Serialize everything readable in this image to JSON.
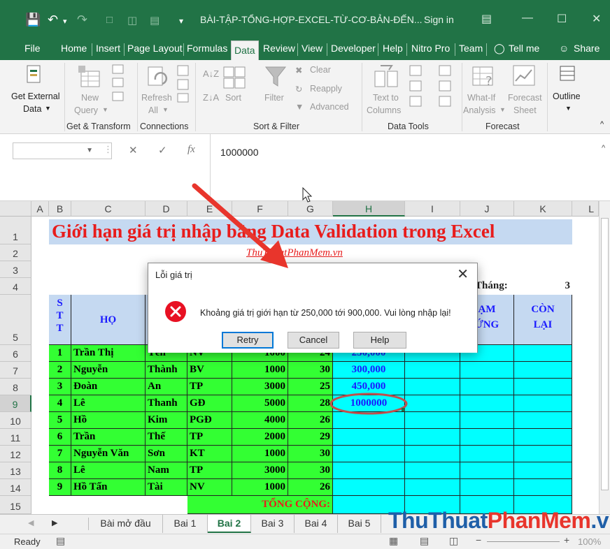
{
  "window": {
    "title": "BÀI-TẬP-TỔNG-HỢP-EXCEL-TỪ-CƠ-BẢN-ĐẾN...",
    "signin": "Sign in"
  },
  "tabs": [
    "File",
    "Home",
    "Insert",
    "Page Layout",
    "Formulas",
    "Data",
    "Review",
    "View",
    "Developer",
    "Help",
    "Nitro Pro",
    "Team"
  ],
  "tell_me": "Tell me",
  "share": "Share",
  "ribbon": {
    "get_external_data_l1": "Get External",
    "get_external_data_l2": "Data",
    "new_query_l1": "New",
    "new_query_l2": "Query",
    "refresh_all_l1": "Refresh",
    "refresh_all_l2": "All",
    "sort": "Sort",
    "filter": "Filter",
    "clear": "Clear",
    "reapply": "Reapply",
    "advanced": "Advanced",
    "text_to_columns_l1": "Text to",
    "text_to_columns_l2": "Columns",
    "what_if_l1": "What-If",
    "what_if_l2": "Analysis",
    "forecast_sheet_l1": "Forecast",
    "forecast_sheet_l2": "Sheet",
    "outline": "Outline",
    "groups": [
      "Get & Transform",
      "Connections",
      "Sort & Filter",
      "Data Tools",
      "Forecast"
    ]
  },
  "formula_bar": {
    "fx": "fx",
    "value": "1000000"
  },
  "columns": [
    "A",
    "B",
    "C",
    "D",
    "E",
    "F",
    "G",
    "H",
    "I",
    "J",
    "K",
    "L"
  ],
  "rows": [
    "1",
    "2",
    "3",
    "4",
    "5",
    "6",
    "7",
    "8",
    "9",
    "10",
    "11",
    "12",
    "13",
    "14",
    "15"
  ],
  "sheet": {
    "title": "Giới hạn giá trị nhập bằng Data Validation trong Excel",
    "subtitle": "ThuThuatPhanMem.vn",
    "month_label": "Tháng:",
    "month_value": "3",
    "header_stt": [
      "S",
      "T",
      "T"
    ],
    "header_ho": "HỌ",
    "header_tam_l1": "ẠM",
    "header_tam_l2": "ỨNG",
    "header_con_l1": "CÒN",
    "header_con_l2": "LẠI",
    "data_rows": [
      {
        "stt": "1",
        "ho": "Trần Thị",
        "ten": "Yến",
        "cv": "NV",
        "f": "1000",
        "g": "24",
        "h": "250,000"
      },
      {
        "stt": "2",
        "ho": "Nguyễn",
        "ten": "Thành",
        "cv": "BV",
        "f": "1000",
        "g": "30",
        "h": "300,000"
      },
      {
        "stt": "3",
        "ho": "Đoàn",
        "ten": "An",
        "cv": "TP",
        "f": "3000",
        "g": "25",
        "h": "450,000"
      },
      {
        "stt": "4",
        "ho": "Lê",
        "ten": "Thanh",
        "cv": "GĐ",
        "f": "5000",
        "g": "28",
        "h": "1000000"
      },
      {
        "stt": "5",
        "ho": "Hồ",
        "ten": "Kim",
        "cv": "PGĐ",
        "f": "4000",
        "g": "26",
        "h": ""
      },
      {
        "stt": "6",
        "ho": "Trần",
        "ten": "Thế",
        "cv": "TP",
        "f": "2000",
        "g": "29",
        "h": ""
      },
      {
        "stt": "7",
        "ho": "Nguyễn Văn",
        "ten": "Sơn",
        "cv": "KT",
        "f": "1000",
        "g": "30",
        "h": ""
      },
      {
        "stt": "8",
        "ho": "Lê",
        "ten": "Nam",
        "cv": "TP",
        "f": "3000",
        "g": "30",
        "h": ""
      },
      {
        "stt": "9",
        "ho": "Hồ Tấn",
        "ten": "Tài",
        "cv": "NV",
        "f": "1000",
        "g": "26",
        "h": ""
      }
    ],
    "total_label": "TỔNG CỘNG:"
  },
  "dialog": {
    "title": "Lỗi giá trị",
    "message": "Khoảng giá trị giới hạn từ 250,000 tới 900,000. Vui lòng nhập lại!",
    "retry": "Retry",
    "cancel": "Cancel",
    "help": "Help"
  },
  "sheet_tabs": [
    "Bài mở đầu",
    "Bai 1",
    "Bai 2",
    "Bai 3",
    "Bai 4",
    "Bai 5"
  ],
  "active_sheet": "Bai 2",
  "watermark": {
    "p1": "ThuThuat",
    "p2": "PhanMem",
    "p3": ".vn"
  },
  "status": {
    "ready": "Ready",
    "zoom": "100%"
  },
  "colors": {
    "excel_green": "#217346",
    "cell_green": "#33ff33",
    "cell_cyan": "#00ffff",
    "header_blue": "#c5d9f1",
    "title_red": "#e81c1c",
    "error_red": "#e81123"
  }
}
